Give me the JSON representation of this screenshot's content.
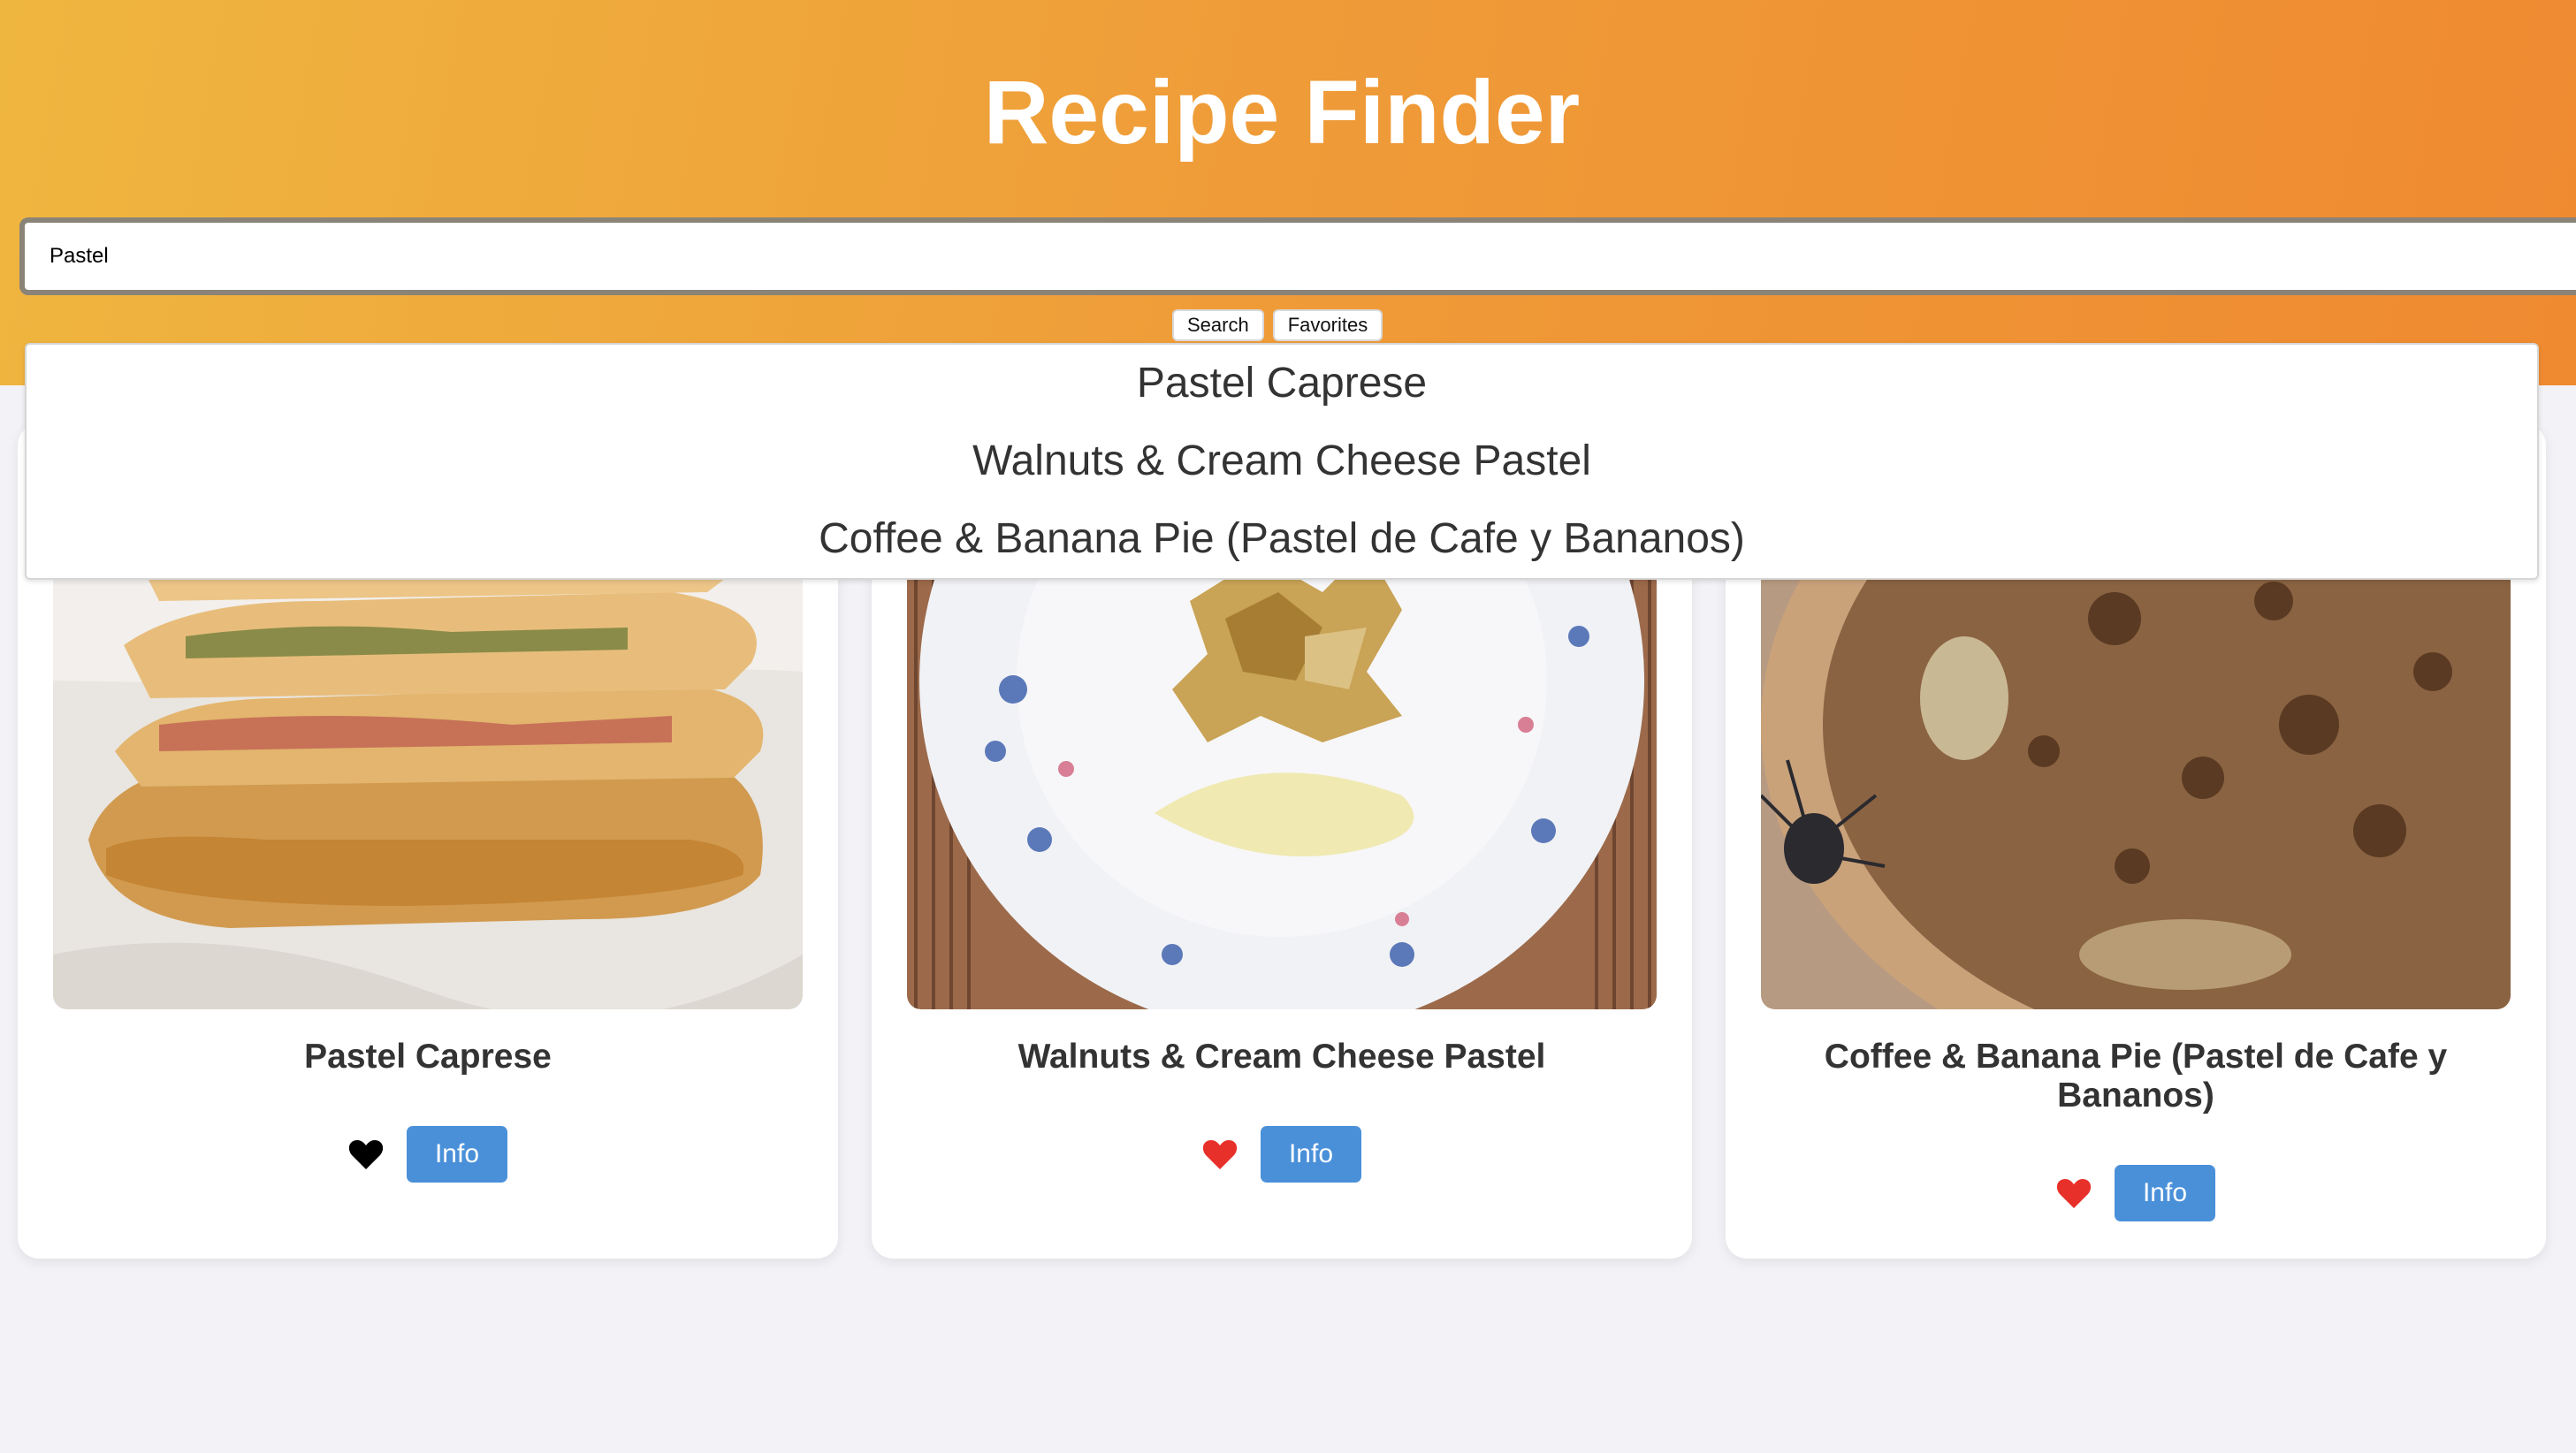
{
  "app": {
    "title": "Recipe Finder"
  },
  "search": {
    "value": "Pastel",
    "search_label": "Search",
    "favorites_label": "Favorites"
  },
  "suggestions": [
    "Pastel Caprese",
    "Walnuts & Cream Cheese Pastel",
    "Coffee & Banana Pie (Pastel de Cafe y Bananos)"
  ],
  "cards": [
    {
      "title": "Pastel Caprese",
      "favorite": false,
      "heart_color": "#000000",
      "info_label": "Info"
    },
    {
      "title": "Walnuts & Cream Cheese Pastel",
      "favorite": true,
      "heart_color": "#e8302a",
      "info_label": "Info"
    },
    {
      "title": "Coffee & Banana Pie (Pastel de Cafe y Bananos)",
      "favorite": true,
      "heart_color": "#e8302a",
      "info_label": "Info"
    }
  ],
  "colors": {
    "header_gradient_start": "#efb63f",
    "header_gradient_end": "#ef8a31",
    "accent_button": "#4a90d9",
    "page_background": "#f3f3f7"
  }
}
